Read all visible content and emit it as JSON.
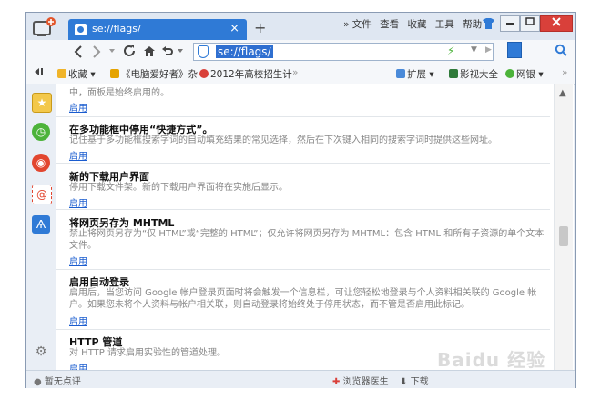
{
  "browser": {
    "tab_title": "se://flags/",
    "tab_close": "×",
    "new_tab": "+",
    "top_menu": [
      "» 文件",
      "查看",
      "收藏",
      "工具",
      "帮助"
    ],
    "url": "se://flags/"
  },
  "bookmarks": [
    "收藏 ▾",
    "《电脑爱好者》杂",
    "2012年高校招生计",
    "»",
    "扩展 ▾",
    "影视大全",
    "网银 ▾",
    "»"
  ],
  "flags": [
    {
      "title": "",
      "desc": "中，面板是始终启用的。",
      "link": "启用"
    },
    {
      "title": "在多功能框中停用“快捷方式”。",
      "desc": "记住基于多功能框搜索字词的自动填充结果的常见选择，然后在下次键入相同的搜索字词时提供这些网址。",
      "link": "启用"
    },
    {
      "title": "新的下载用户界面",
      "desc": "停用下载文件架。新的下载用户界面将在实施后显示。",
      "link": "启用"
    },
    {
      "title": "将网页另存为 MHTML",
      "desc": "禁止将网页另存为“仅 HTML”或“完整的 HTML”；仅允许将网页另存为 MHTML：包含 HTML 和所有子资源的单个文本文件。",
      "link": "启用"
    },
    {
      "title": "启用自动登录",
      "desc": "启用后，当您访问 Google 帐户登录页面时将会触发一个信息栏，可让您轻松地登录与个人资料相关联的 Google 帐户。如果您未将个人资料与帐户相关联，则自动登录将始终处于停用状态，而不管是否启用此标记。",
      "link": "启用"
    },
    {
      "title": "HTTP 管道",
      "desc": "对 HTTP 请求启用实验性的管道处理。",
      "link": "启用"
    }
  ],
  "status": {
    "comments": "暂无点评",
    "doctor": "浏览器医生",
    "download": "下载"
  },
  "watermark": "Baidu 经验",
  "colors": {
    "accent": "#2f7ad6",
    "close": "#d9403a",
    "link": "#1a5ccf"
  }
}
